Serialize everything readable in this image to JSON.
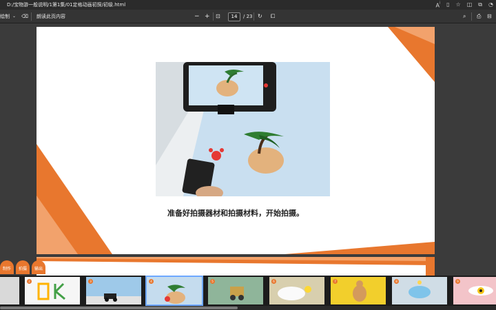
{
  "address_bar": {
    "path": "D:/宝物游一般说明/1第1集/01定格动画初探/初级.html"
  },
  "toolbar": {
    "draw_label": "绘制",
    "read_aloud_label": "朗读此页内容",
    "zoom_out": "−",
    "zoom_in": "+",
    "current_page": "14",
    "total_pages": "/ 23"
  },
  "page": {
    "caption": "准备好拍摄器材和拍摄材料，开始拍摄。"
  },
  "side_tabs": [
    {
      "label": "制作"
    },
    {
      "label": "拍摄"
    },
    {
      "label": "输出"
    }
  ],
  "thumbnails": [
    {
      "number": "1"
    },
    {
      "number": "2"
    },
    {
      "number": "3"
    },
    {
      "number": "4"
    },
    {
      "number": "5"
    },
    {
      "number": "6"
    },
    {
      "number": "7"
    },
    {
      "number": "8"
    },
    {
      "number": "9"
    }
  ],
  "icons": [
    "read-aloud-icon",
    "favorite-icon",
    "reading-view-icon",
    "collections-icon",
    "eraser-icon",
    "fit-page-icon",
    "rotate-icon",
    "two-page-icon",
    "search-icon",
    "print-icon",
    "save-icon"
  ],
  "colors": {
    "accent": "#e8772e",
    "toolbar": "#343434",
    "background": "#3b3b3b"
  }
}
